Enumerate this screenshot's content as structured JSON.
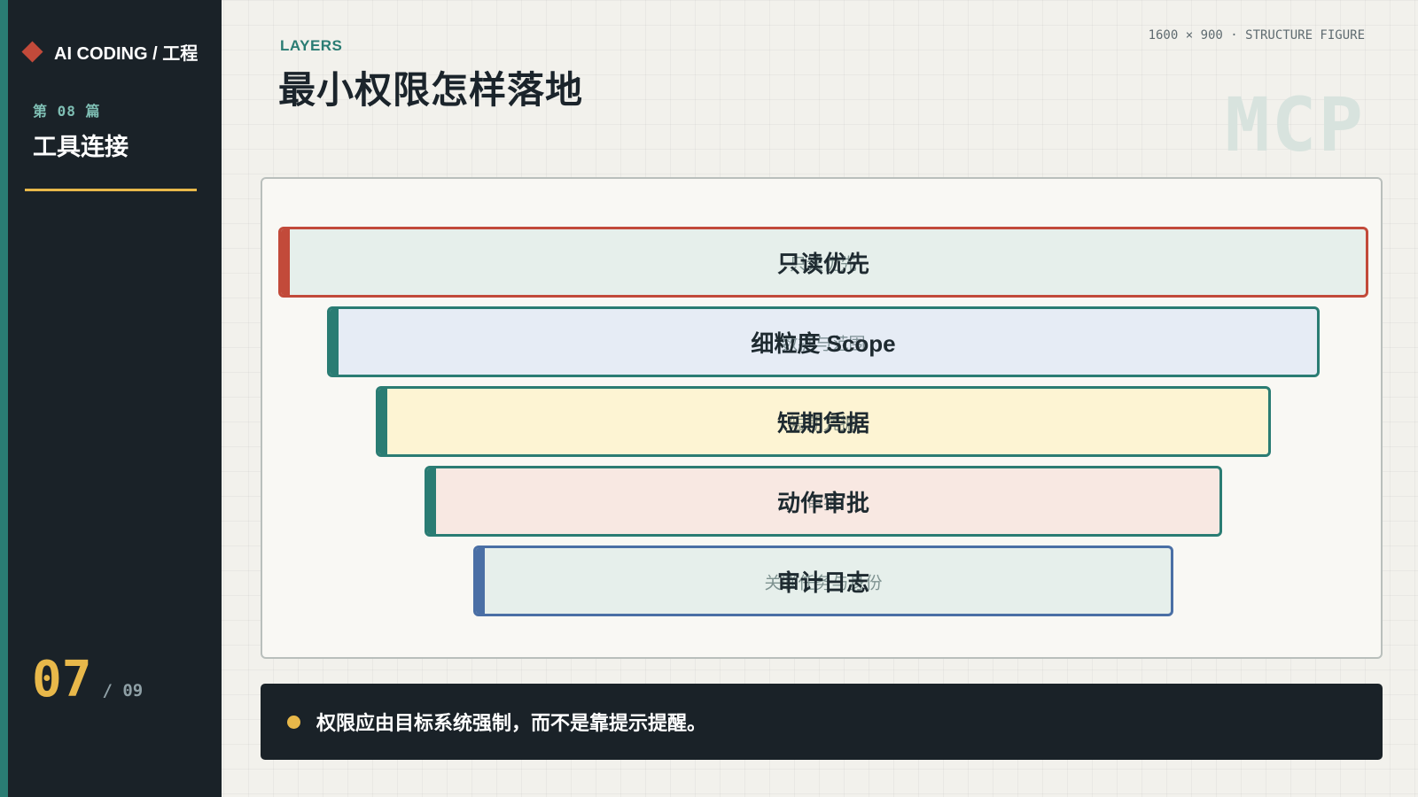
{
  "sidebar": {
    "brand": "AI CODING / 工程",
    "chapter_number": "第 08 篇",
    "chapter_title": "工具连接",
    "page_current": "07",
    "page_total": "/ 09"
  },
  "header": {
    "eyebrow": "LAYERS",
    "title": "最小权限怎样落地",
    "meta": "1600 × 900 · STRUCTURE FIGURE",
    "watermark": "MCP"
  },
  "layers": [
    {
      "label": "只读优先",
      "sub": "只读优先",
      "accent": "#c24a3a",
      "fill": "#e6efeb"
    },
    {
      "label": "细粒度 Scope",
      "sub": "数据与范围",
      "accent": "#2a7c73",
      "fill": "#e6ecf5"
    },
    {
      "label": "短期凭据",
      "sub": "短期凭据",
      "accent": "#2a7c73",
      "fill": "#fdf4d3"
    },
    {
      "label": "动作审批",
      "sub": "审批",
      "accent": "#2a7c73",
      "fill": "#f8e8e2"
    },
    {
      "label": "审计日志",
      "sub": "关联任务与身份",
      "accent": "#4a6fa5",
      "fill": "#e6efeb"
    }
  ],
  "callout": {
    "text": "权限应由目标系统强制，而不是靠提示提醒。"
  },
  "colors": {
    "sidebar_bg": "#1a2228",
    "teal": "#2a7c73",
    "gold": "#e8b84a",
    "red": "#c24a3a",
    "blue": "#4a6fa5"
  }
}
